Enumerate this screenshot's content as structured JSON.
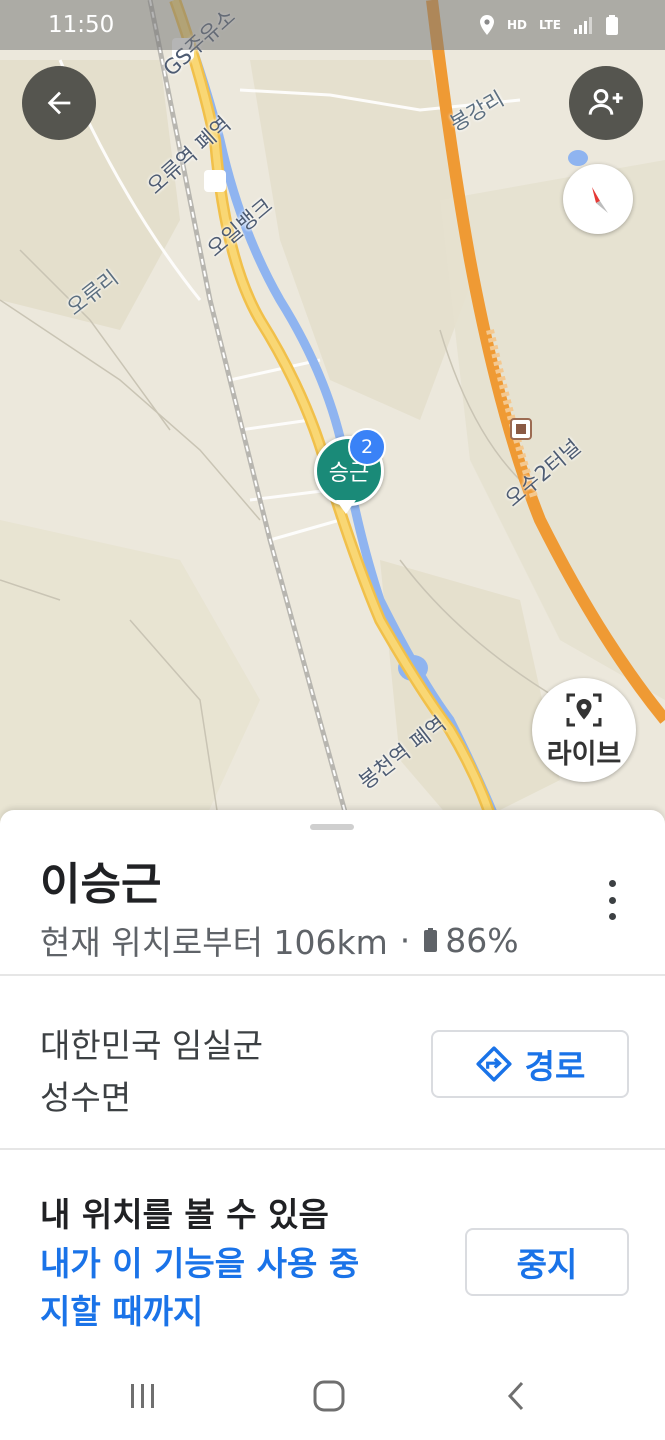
{
  "status_bar": {
    "time": "11:50",
    "network_labels": [
      "HD",
      "LTE"
    ]
  },
  "map": {
    "labels": {
      "gs_station": "GS주유소",
      "oryu_station": "오류역 폐역",
      "oil_bank": "오일뱅크",
      "oryu_ri": "오류리",
      "bonggang_ri": "봉강리",
      "osu_tunnel": "오수2터널",
      "bongcheon_station": "봉천역 폐역"
    },
    "marker": {
      "label": "승근",
      "badge": "2",
      "color": "#1a8a78",
      "badge_color": "#3a82f7"
    },
    "live_button_label": "라이브",
    "icons": [
      "arrow-left-icon",
      "add-person-icon",
      "compass-icon",
      "live-pin-icon"
    ]
  },
  "sheet": {
    "name": "이승근",
    "distance_text": "현재 위치로부터 106km",
    "separator": "·",
    "battery_text": "86%",
    "address_line1": "대한민국 임실군",
    "address_line2": "성수면",
    "directions_label": "경로",
    "share_title": "내 위치를 볼 수 있음",
    "share_duration": "내가 이 기능을 사용 중지할 때까지",
    "stop_label": "중지",
    "accent_color": "#1a73e8"
  },
  "nav_bar": {
    "icons": [
      "recent-apps-icon",
      "home-icon",
      "back-icon"
    ]
  }
}
